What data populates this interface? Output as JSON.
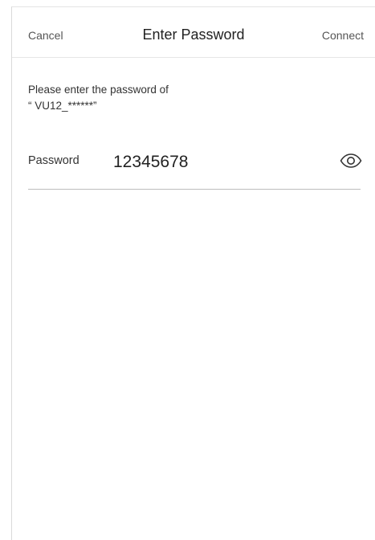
{
  "header": {
    "cancel_label": "Cancel",
    "title": "Enter Password",
    "connect_label": "Connect"
  },
  "prompt": {
    "line1": "Please enter the password of",
    "line2": "“ VU12_******”"
  },
  "password_field": {
    "label": "Password",
    "value": "12345678",
    "toggle_icon": "eye-icon"
  }
}
